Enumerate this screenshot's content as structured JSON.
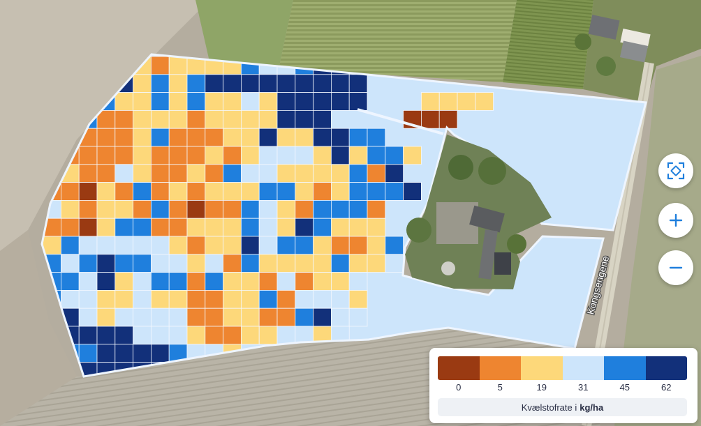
{
  "legend": {
    "colors": [
      "#9a3a12",
      "#ee8530",
      "#fdd87a",
      "#cde5fb",
      "#1f7fdd",
      "#12307a"
    ],
    "values": [
      "0",
      "5",
      "19",
      "31",
      "45",
      "62"
    ],
    "caption_text": "Kvælstofrate i",
    "caption_unit": "kg/ha"
  },
  "road_label": "Kongsengene",
  "controls": {
    "recenter_icon": "recenter-icon",
    "zoom_in_icon": "plus-icon",
    "zoom_out_icon": "minus-icon"
  },
  "rate_grid": {
    "origin": [
      10,
      3
    ],
    "codes": "0123456",
    "rows": [
      "____66532333354456666____________",
      "___55663535666666666__________",
      "___52533535334366666___3333",
      "__2552233323333666____111",
      "__5222235222336336655____",
      "__322223222323444363553",
      "__23224322325443333526__",
      "__221325232333553235556",
      "_54323325212254325552",
      "_32213552233354365333",
      "_335444443233645532235",
      "_554565544342533335334",
      "65554634552533242334",
      "55544334332233524443",
      "56664344442233225644",
      "5666666444322334434",
      "5665566665443",
      "5566666666566",
      "55666566556"
    ]
  }
}
